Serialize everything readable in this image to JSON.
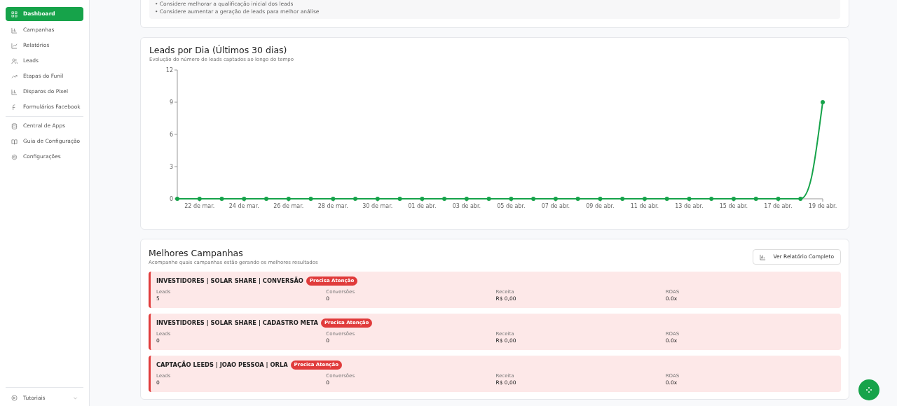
{
  "sidebar": {
    "groups": [
      [
        {
          "label": "Dashboard",
          "selected": true
        },
        {
          "label": "Campanhas",
          "selected": false
        },
        {
          "label": "Relatórios",
          "selected": false
        },
        {
          "label": "Leads",
          "selected": false
        },
        {
          "label": "Etapas do Funil",
          "selected": false
        },
        {
          "label": "Disparos do Pixel",
          "selected": false
        },
        {
          "label": "Formulários Facebook",
          "selected": false
        }
      ],
      [
        {
          "label": "Central de Apps",
          "selected": false
        },
        {
          "label": "Guia de Configuração",
          "selected": false
        },
        {
          "label": "Configurações",
          "selected": false
        }
      ]
    ],
    "footer": {
      "label": "Tutoriais",
      "expanded": false
    }
  },
  "insights": [
    "• Considere melhorar a qualificação inicial dos leads",
    "• Considere aumentar a geração de leads para melhor análise"
  ],
  "leads_chart": {
    "title": "Leads por Dia (Últimos 30 dias)",
    "subtitle": "Evolução do número de leads captados ao longo do tempo",
    "chart_data": {
      "type": "line",
      "categories": [
        null,
        "22 de mar.",
        null,
        "24 de mar.",
        null,
        "26 de mar.",
        null,
        "28 de mar.",
        null,
        "30 de mar.",
        null,
        "01 de abr.",
        null,
        "03 de abr.",
        null,
        "05 de abr.",
        null,
        "07 de abr.",
        null,
        "09 de abr.",
        null,
        "11 de abr.",
        null,
        "13 de abr.",
        null,
        "15 de abr.",
        null,
        "17 de abr.",
        null,
        "19 de abr."
      ],
      "series": [
        {
          "color": "#16a34a",
          "marker": true,
          "values": [
            0,
            0,
            0,
            0,
            0,
            0,
            0,
            0,
            0,
            0,
            0,
            0,
            0,
            0,
            0,
            0,
            0,
            0,
            0,
            0,
            0,
            0,
            0,
            0,
            0,
            0,
            0,
            0,
            0,
            9
          ]
        }
      ],
      "ylim": [
        0,
        12
      ],
      "yticks": [
        0,
        3,
        6,
        9,
        12
      ]
    }
  },
  "campaigns": {
    "title": "Melhores Campanhas",
    "subtitle": "Acompanhe quais campanhas estão gerando os melhores resultados",
    "button": "Ver Relatório Completo",
    "items": [
      {
        "name": "INVESTIDORES | SOLAR SHARE | CONVERSÃO",
        "badge": "Precisa Atenção",
        "stats": [
          {
            "label": "Leads",
            "value": "5"
          },
          {
            "label": "Conversões",
            "value": "0"
          },
          {
            "label": "Receita",
            "value": "R$ 0,00"
          },
          {
            "label": "ROAS",
            "value": "0.0x"
          }
        ]
      },
      {
        "name": "INVESTIDORES | SOLAR SHARE | CADASTRO META",
        "badge": "Precisa Atenção",
        "stats": [
          {
            "label": "Leads",
            "value": "0"
          },
          {
            "label": "Conversões",
            "value": "0"
          },
          {
            "label": "Receita",
            "value": "R$ 0,00"
          },
          {
            "label": "ROAS",
            "value": "0.0x"
          }
        ]
      },
      {
        "name": "CAPTAÇÃO LEEDS | JOAO PESSOA | ORLA",
        "badge": "Precisa Atenção",
        "stats": [
          {
            "label": "Leads",
            "value": "0"
          },
          {
            "label": "Conversões",
            "value": "0"
          },
          {
            "label": "Receita",
            "value": "R$ 0,00"
          },
          {
            "label": "ROAS",
            "value": "0.0x"
          }
        ]
      }
    ]
  }
}
